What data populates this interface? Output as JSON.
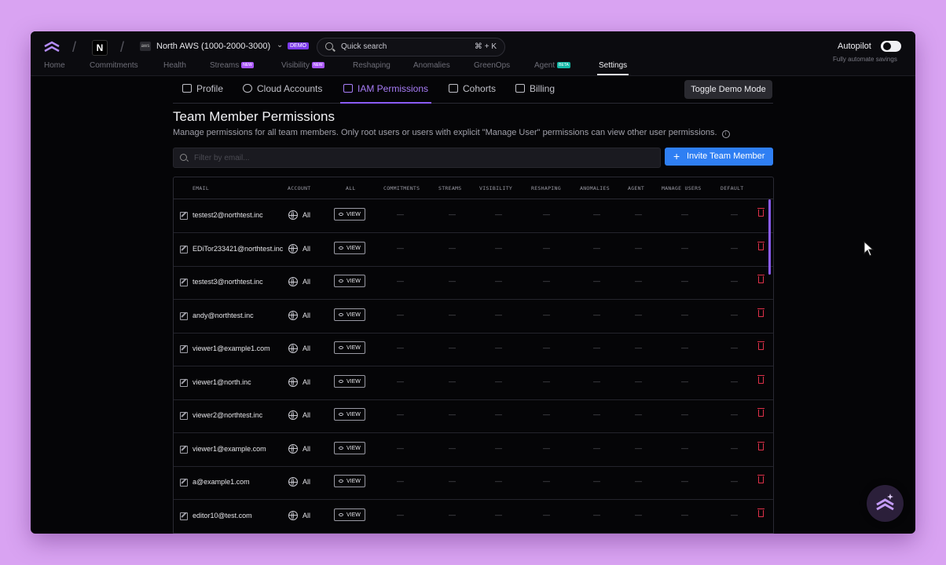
{
  "header": {
    "org_initial": "N",
    "account_icon_text": "aws",
    "account_name": "North AWS (1000-2000-3000)",
    "account_badge": "DEMO",
    "search_placeholder": "Quick search",
    "search_shortcut": "⌘ + K",
    "autopilot_label": "Autopilot",
    "autopilot_sub": "Fully automate savings"
  },
  "nav": {
    "items": [
      {
        "label": "Home"
      },
      {
        "label": "Commitments"
      },
      {
        "label": "Health"
      },
      {
        "label": "Streams",
        "badge": "NEW"
      },
      {
        "label": "Visibility",
        "badge": "NEW"
      },
      {
        "label": "Reshaping"
      },
      {
        "label": "Anomalies"
      },
      {
        "label": "GreenOps"
      },
      {
        "label": "Agent",
        "badge": "BETA"
      },
      {
        "label": "Settings"
      }
    ]
  },
  "subtabs": [
    "Profile",
    "Cloud Accounts",
    "IAM Permissions",
    "Cohorts",
    "Billing"
  ],
  "toggle_demo_label": "Toggle Demo Mode",
  "page": {
    "title": "Team Member Permissions",
    "description": "Manage permissions for all team members. Only root users or users with explicit \"Manage User\" permissions can view other user permissions.",
    "filter_placeholder": "Filter by email...",
    "invite_label": "Invite Team Member"
  },
  "table": {
    "columns": [
      "EMAIL",
      "ACCOUNT",
      "ALL",
      "COMMITMENTS",
      "STREAMS",
      "VISIBILITY",
      "RESHAPING",
      "ANOMALIES",
      "AGENT",
      "MANAGE USERS",
      "DEFAULT"
    ],
    "account_value": "All",
    "view_label": "VIEW",
    "dash": "—",
    "rows": [
      {
        "email": "testest2@northtest.inc"
      },
      {
        "email": "EDiTor233421@northtest.inc"
      },
      {
        "email": "testest3@northtest.inc"
      },
      {
        "email": "andy@northtest.inc"
      },
      {
        "email": "viewer1@example1.com"
      },
      {
        "email": "viewer1@north.inc"
      },
      {
        "email": "viewer2@northtest.inc"
      },
      {
        "email": "viewer1@example.com"
      },
      {
        "email": "a@example1.com"
      },
      {
        "email": "editor10@test.com"
      }
    ]
  },
  "colors": {
    "accent": "#8b5cf6",
    "primary_button": "#2f7ff3",
    "delete": "#e0314a",
    "page_background": "#d9a3f2"
  }
}
